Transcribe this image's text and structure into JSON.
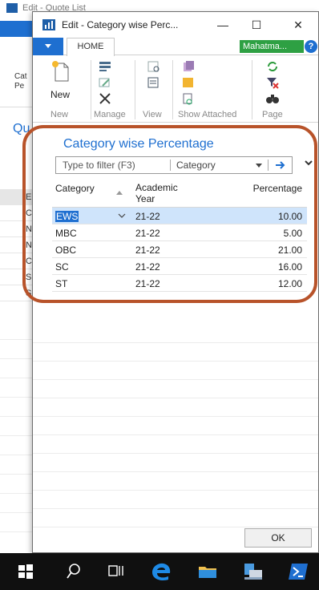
{
  "background_window": {
    "title": "Edit - Quote List",
    "ribbon_label": "Cat Pe",
    "page_title": "Qu",
    "rows": [
      "E",
      "C",
      "N",
      "N",
      "C",
      "S",
      "S"
    ]
  },
  "dialog": {
    "title": "Edit - Category wise Perc...",
    "controls": {
      "minimize": "—",
      "maximize": "☐",
      "close": "✕"
    },
    "tabs": [
      {
        "label": "HOME",
        "active": true
      }
    ],
    "company": "Mahatma...",
    "help": "?",
    "ribbon": {
      "groups": [
        {
          "label": "New",
          "actions": [
            {
              "label": "New",
              "icon": "new-document-icon"
            }
          ]
        },
        {
          "label": "Manage",
          "actions": [
            {
              "icon": "edit-list-icon"
            },
            {
              "icon": "edit-icon"
            },
            {
              "icon": "delete-icon"
            }
          ]
        },
        {
          "label": "View",
          "actions": [
            {
              "icon": "view-icon"
            },
            {
              "icon": "view-list-icon"
            }
          ]
        },
        {
          "label": "Show Attached",
          "actions": [
            {
              "icon": "notes-icon"
            },
            {
              "icon": "notes-yellow-icon"
            },
            {
              "icon": "links-icon"
            }
          ]
        },
        {
          "label": "Page",
          "actions": [
            {
              "icon": "refresh-icon"
            },
            {
              "icon": "clear-filter-icon"
            },
            {
              "icon": "find-icon"
            }
          ]
        }
      ]
    },
    "page_title": "Category wise Percentage",
    "filter": {
      "placeholder": "Type to filter (F3)",
      "field": "Category"
    },
    "grid": {
      "columns": [
        "Category",
        "Academic Year",
        "Percentage"
      ],
      "rows": [
        {
          "category": "EWS",
          "year": "21-22",
          "percentage": "10.00",
          "selected": true
        },
        {
          "category": "MBC",
          "year": "21-22",
          "percentage": "5.00"
        },
        {
          "category": "OBC",
          "year": "21-22",
          "percentage": "21.00"
        },
        {
          "category": "SC",
          "year": "21-22",
          "percentage": "16.00"
        },
        {
          "category": "ST",
          "year": "21-22",
          "percentage": "12.00"
        }
      ]
    },
    "ok_label": "OK"
  },
  "taskbar": {
    "items": [
      "windows-start-icon",
      "search-icon",
      "task-view-icon",
      "edge-icon",
      "file-explorer-icon",
      "network-icon",
      "powershell-icon"
    ]
  },
  "colors": {
    "accent_blue": "#1e6fd0",
    "company_green": "#2ea043",
    "highlight_ring": "#b8532a",
    "selected_row": "#cfe4fb",
    "taskbar": "#101010"
  }
}
